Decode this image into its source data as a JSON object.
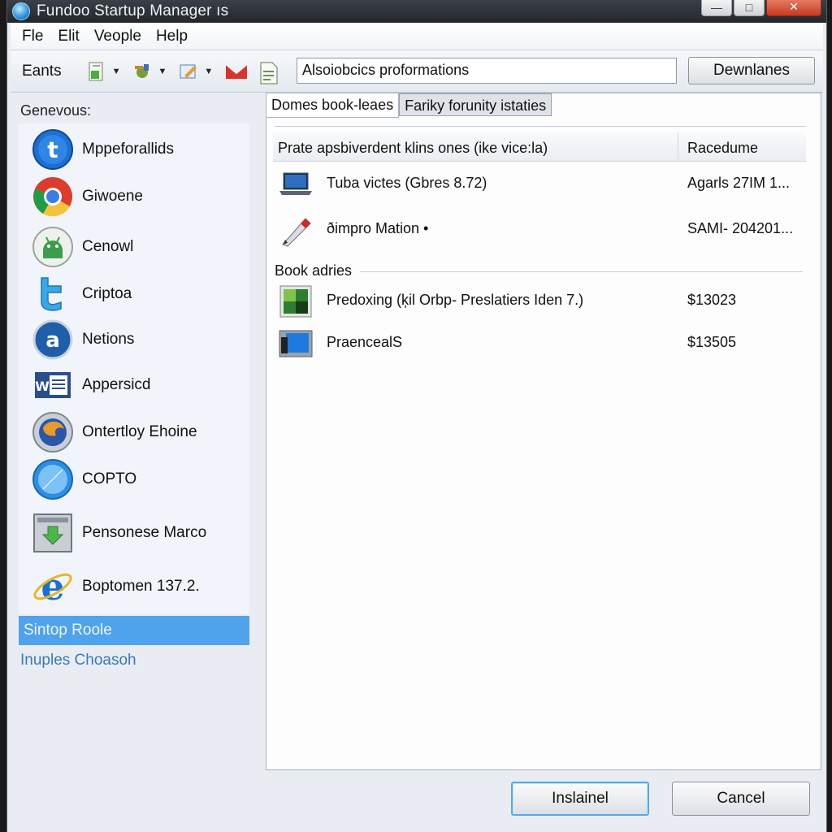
{
  "window": {
    "title": "Fundoo Startup Manager ıs"
  },
  "menu": [
    "Fle",
    "Elit",
    "Veople",
    "Help"
  ],
  "toolbar": {
    "label": "Eants",
    "search_value": "Alsoiobcics proformations",
    "download_label": "Dewnlanes",
    "icons": [
      "green-file-icon",
      "tools-icon",
      "edit-icon",
      "mail-icon",
      "document-icon"
    ]
  },
  "sidebar": {
    "heading": "Genevous:",
    "items": [
      {
        "label": "Mppeforallids",
        "icon": "t-globe-icon"
      },
      {
        "label": "Giwoene",
        "icon": "chrome-icon"
      },
      {
        "label": "Cenowl",
        "icon": "android-icon"
      },
      {
        "label": "Criptoa",
        "icon": "twitter-bird-icon"
      },
      {
        "label": "Netions",
        "icon": "a-circle-icon"
      },
      {
        "label": "Appersicd",
        "icon": "word-icon"
      },
      {
        "label": "Ontertloy Ehoine",
        "icon": "firefox-icon"
      },
      {
        "label": "COPTO",
        "icon": "safari-icon"
      },
      {
        "label": "Pensonese Marco",
        "icon": "download-arrow-icon"
      },
      {
        "label": "Boptomen 137.2.",
        "icon": "internet-explorer-icon"
      }
    ],
    "selected": "Sintop Roole",
    "link": "Inuples Choasoh"
  },
  "content": {
    "tabs": [
      "Domes book-leaes",
      "Fariky forunity istaties"
    ],
    "table": {
      "columns": [
        "Prate apsbiverdent klins ones (ike vice:la)",
        "Racedume"
      ],
      "rows": [
        {
          "name": "Tuba victes (Gbres 8.72)",
          "value": "Agarls 27IM 1...",
          "icon": "laptop-icon"
        },
        {
          "name": "ðimpro Mation •",
          "value": "SAMI- 204201...",
          "icon": "pen-icon"
        }
      ]
    },
    "group": {
      "title": "Book adries",
      "rows": [
        {
          "name": "Predoxing (ķil Orbp- Preslatiers Iden 7.)",
          "value": "$13023",
          "icon": "green-app-icon"
        },
        {
          "name": "PraencealS",
          "value": "$13505",
          "icon": "monitor-icon"
        }
      ]
    }
  },
  "footer": {
    "install_label": "Inslainel",
    "cancel_label": "Cancel"
  },
  "colors": {
    "selection": "#4fa3ec",
    "link": "#3a78bc",
    "titlebar": "#2b2f35"
  }
}
